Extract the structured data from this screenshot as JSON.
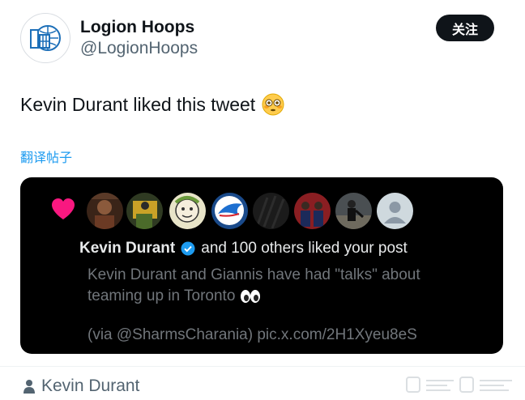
{
  "account": {
    "display_name": "Logion Hoops",
    "handle": "@LogionHoops",
    "avatar_icon": "logion-hoops-logo"
  },
  "follow_label": "关注",
  "tweet": {
    "text": "Kevin Durant liked this tweet",
    "emoji": "flushed-face-emoji"
  },
  "translate_label": "翻译帖子",
  "card": {
    "icon": "heart-icon",
    "avatars": [
      "avatar-photo-1",
      "avatar-photo-2",
      "avatar-cartoon",
      "avatar-blue-jays",
      "avatar-dark",
      "avatar-team-photo",
      "avatar-game-photo",
      "avatar-default"
    ],
    "name": "Kevin Durant",
    "verified_icon": "verified-badge-icon",
    "notification_rest": "and 100 others liked your post",
    "quote_line1": "Kevin Durant and Giannis have had \"talks\" about",
    "quote_line2": "teaming up in Toronto",
    "quote_emoji": "eyes-emoji",
    "source": "(via @SharmsCharania) pic.x.com/2H1Xyeu8eS"
  },
  "author_line": {
    "icon": "person-icon",
    "name": "Kevin Durant"
  },
  "colors": {
    "accent_blue": "#1d9bf0",
    "heart_pink": "#f91880",
    "card_bg": "#000000"
  }
}
